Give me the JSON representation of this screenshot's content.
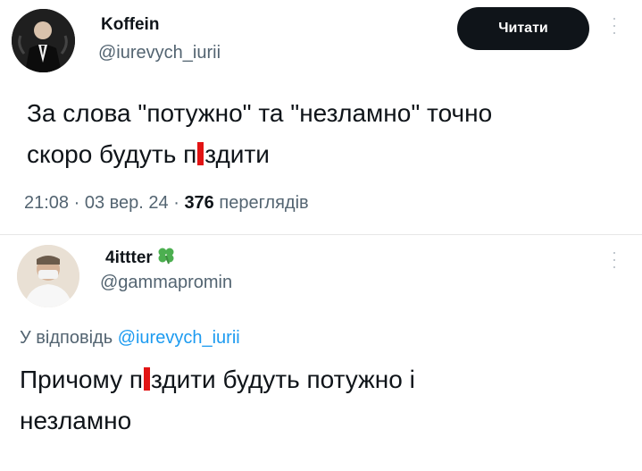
{
  "post1": {
    "author_name": "Koffein",
    "author_handle": "@iurevych_iurii",
    "follow_label": "Читати",
    "text_line1": "За слова \"потужно\" та \"незламно\" точно",
    "text_line2_pre": "скоро будуть п",
    "text_line2_post": "здити",
    "time": "21:08",
    "date": "03 вер. 24",
    "views_count": "376",
    "views_label": "переглядів"
  },
  "post2": {
    "author_name": "4ittter",
    "author_badge_icon": "four-leaf-clover",
    "author_handle": "@gammapromin",
    "reply_prefix": "У відповідь",
    "reply_mention": "@iurevych_iurii",
    "text_line1_pre": "Причому п",
    "text_line1_post": "здити будуть потужно і",
    "text_line2": "незламно"
  },
  "colors": {
    "censor": "#e21414",
    "link": "#1d9bf0",
    "secondary": "#536471",
    "button_bg": "#0f1419"
  }
}
